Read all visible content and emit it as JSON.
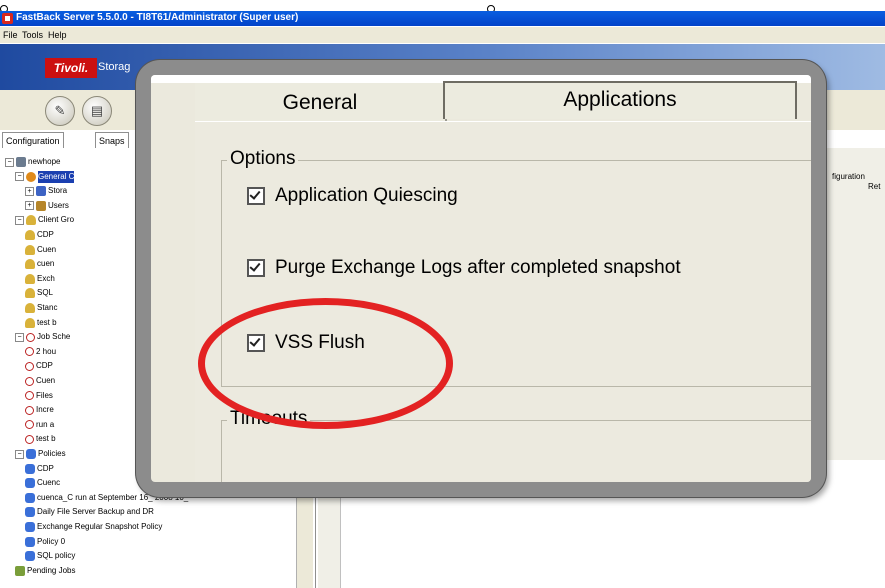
{
  "window": {
    "title": "FastBack Server 5.5.0.0 - TI8T61/Administrator (Super user)"
  },
  "menu": [
    "File",
    "Tools",
    "Help"
  ],
  "banner": {
    "logo": "Tivoli.",
    "product": "Storag"
  },
  "left_tabs": [
    "Configuration",
    "Snaps"
  ],
  "tree": [
    {
      "label": "newhope",
      "icon": "server-icon"
    },
    {
      "label": "General C",
      "icon": "gear-icon",
      "selected": true
    },
    {
      "label": "Stora",
      "icon": "storage-icon"
    },
    {
      "label": "Users",
      "icon": "users-icon"
    },
    {
      "label": "Client Gro",
      "icon": "client-group-icon"
    },
    {
      "label": "CDP",
      "icon": "client-icon"
    },
    {
      "label": "Cuen",
      "icon": "client-icon"
    },
    {
      "label": "cuen",
      "icon": "client-icon"
    },
    {
      "label": "Exch",
      "icon": "client-icon"
    },
    {
      "label": "SQL",
      "icon": "client-icon"
    },
    {
      "label": "Stanc",
      "icon": "client-icon"
    },
    {
      "label": "test b",
      "icon": "client-icon"
    },
    {
      "label": "Job Sche",
      "icon": "job-icon"
    },
    {
      "label": "2 hou",
      "icon": "job-icon"
    },
    {
      "label": "CDP",
      "icon": "job-icon"
    },
    {
      "label": "Cuen",
      "icon": "job-icon"
    },
    {
      "label": "Files",
      "icon": "job-icon"
    },
    {
      "label": "Incre",
      "icon": "job-icon"
    },
    {
      "label": "run a",
      "icon": "job-icon"
    },
    {
      "label": "test b",
      "icon": "job-icon"
    },
    {
      "label": "Policies",
      "icon": "policies-icon"
    },
    {
      "label": "CDP",
      "icon": "policy-icon"
    },
    {
      "label": "Cuenc",
      "icon": "policy-icon"
    },
    {
      "label": "cuenca_C run at September 16_ 2008 10_",
      "icon": "policy-icon"
    },
    {
      "label": "Daily File Server Backup and DR",
      "icon": "policy-icon"
    },
    {
      "label": "Exchange Regular Snapshot Policy",
      "icon": "policy-icon"
    },
    {
      "label": "Policy 0",
      "icon": "policy-icon"
    },
    {
      "label": "SQL policy",
      "icon": "policy-icon"
    },
    {
      "label": "Pending Jobs",
      "icon": "pending-jobs-icon"
    }
  ],
  "right_fragments": {
    "line1": "figuration",
    "line2": "Ret"
  },
  "zoom": {
    "tabs": {
      "general": "General",
      "applications": "Applications"
    },
    "options_legend": "Options",
    "checkboxes": [
      {
        "label": "Application Quiescing",
        "checked": true
      },
      {
        "label": "Purge Exchange Logs after completed snapshot",
        "checked": true
      },
      {
        "label": "VSS Flush",
        "checked": true
      }
    ],
    "timeouts_legend": "Timeouts"
  },
  "colors": {
    "highlight": "#e32222",
    "title_bar": "#0a5ee0",
    "selection": "#1a3fb0"
  }
}
